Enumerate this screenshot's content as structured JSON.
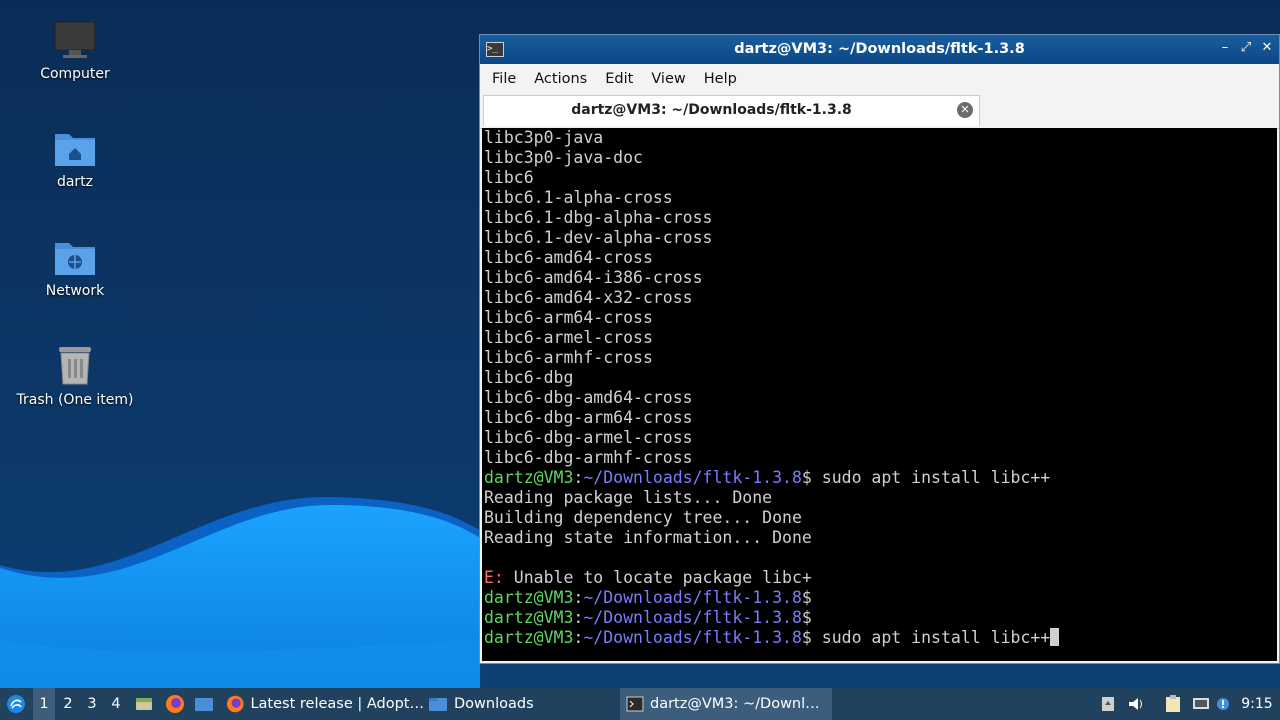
{
  "desktop": {
    "icons": [
      {
        "label": "Computer",
        "icon": "computer-icon"
      },
      {
        "label": "dartz",
        "icon": "home-folder-icon"
      },
      {
        "label": "Network",
        "icon": "network-folder-icon"
      },
      {
        "label": "Trash (One item)",
        "icon": "trash-icon"
      }
    ]
  },
  "terminal": {
    "title": "dartz@VM3: ~/Downloads/fltk-1.3.8",
    "menu": [
      "File",
      "Actions",
      "Edit",
      "View",
      "Help"
    ],
    "tab_label": "dartz@VM3: ~/Downloads/fltk-1.3.8",
    "prompt_user": "dartz@VM3",
    "prompt_path": "~/Downloads/fltk-1.3.8",
    "output_lines": [
      "libc3p0-java",
      "libc3p0-java-doc",
      "libc6",
      "libc6.1-alpha-cross",
      "libc6.1-dbg-alpha-cross",
      "libc6.1-dev-alpha-cross",
      "libc6-amd64-cross",
      "libc6-amd64-i386-cross",
      "libc6-amd64-x32-cross",
      "libc6-arm64-cross",
      "libc6-armel-cross",
      "libc6-armhf-cross",
      "libc6-dbg",
      "libc6-dbg-amd64-cross",
      "libc6-dbg-arm64-cross",
      "libc6-dbg-armel-cross",
      "libc6-dbg-armhf-cross"
    ],
    "cmd1": "sudo apt install libc++",
    "apt_lines": [
      "Reading package lists... Done",
      "Building dependency tree... Done",
      "Reading state information... Done"
    ],
    "error_prefix": "E:",
    "error_text": " Unable to locate package libc+",
    "cmd_last": "sudo apt install libc++"
  },
  "taskbar": {
    "workspaces": [
      "1",
      "2",
      "3",
      "4"
    ],
    "active_workspace": "1",
    "tasks": [
      {
        "label": "Latest release | Adopt…",
        "icon": "firefox-icon"
      },
      {
        "label": "Downloads",
        "icon": "folder-icon"
      },
      {
        "label": "dartz@VM3: ~/Downl…",
        "icon": "terminal-icon"
      }
    ],
    "clock": "9:15"
  },
  "colors": {
    "accent": "#0e4d8b",
    "prompt_user": "#5fd75f",
    "prompt_path": "#7b7bff",
    "error": "#ff6b6b"
  }
}
